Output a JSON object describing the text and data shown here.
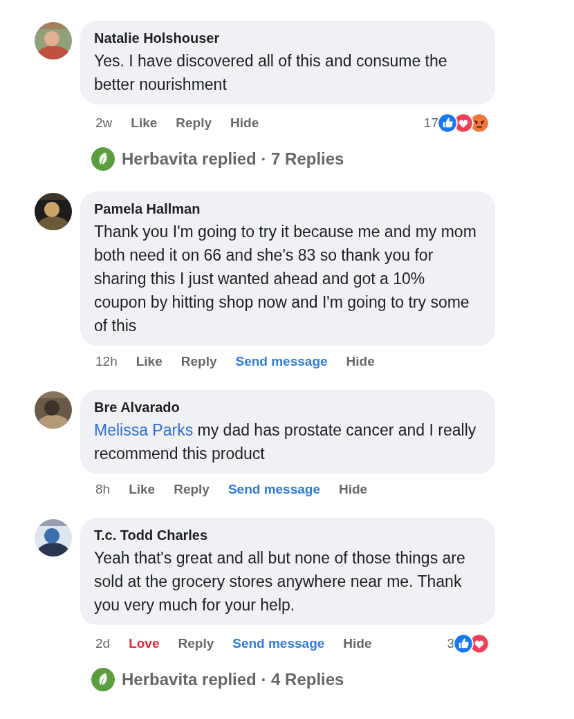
{
  "comments": [
    {
      "author": "Natalie Holshouser",
      "text": "Yes. I have discovered all of this and consume the better nourishment",
      "time": "2w",
      "actions": [
        {
          "label": "Like",
          "kind": "react",
          "reacted": false
        },
        {
          "label": "Reply",
          "kind": "reply"
        },
        {
          "label": "Hide",
          "kind": "hide"
        }
      ],
      "reactions": {
        "count": "17",
        "icons": [
          {
            "kind": "like"
          },
          {
            "kind": "love"
          },
          {
            "kind": "angry"
          }
        ]
      },
      "replies": "Herbavita replied · 7 Replies"
    },
    {
      "author": "Pamela Hallman",
      "text": "Thank you I'm going to try it because me and my mom both need it on 66 and she's 83 so thank you for sharing this I just wanted ahead and got a 10% coupon by hitting shop now and I'm going to try some of this",
      "time": "12h",
      "actions": [
        {
          "label": "Like",
          "kind": "react",
          "reacted": false
        },
        {
          "label": "Reply",
          "kind": "reply"
        },
        {
          "label": "Send message",
          "kind": "message"
        },
        {
          "label": "Hide",
          "kind": "hide"
        }
      ]
    },
    {
      "author": "Bre Alvarado",
      "mention": "Melissa Parks",
      "text": "my dad has prostate cancer and I really recommend this product",
      "time": "8h",
      "actions": [
        {
          "label": "Like",
          "kind": "react",
          "reacted": false
        },
        {
          "label": "Reply",
          "kind": "reply"
        },
        {
          "label": "Send message",
          "kind": "message"
        },
        {
          "label": "Hide",
          "kind": "hide"
        }
      ]
    },
    {
      "author": "T.c. Todd Charles",
      "text": "Yeah that's great and all but none of those things are sold at the grocery stores anywhere near me. Thank you very much for your help.",
      "time": "2d",
      "actions": [
        {
          "label": "Love",
          "kind": "react",
          "reacted": true
        },
        {
          "label": "Reply",
          "kind": "reply"
        },
        {
          "label": "Send message",
          "kind": "message"
        },
        {
          "label": "Hide",
          "kind": "hide"
        }
      ],
      "reactions": {
        "count": "3",
        "icons": [
          {
            "kind": "like"
          },
          {
            "kind": "love"
          }
        ]
      },
      "replies": "Herbavita replied · 4 Replies"
    }
  ]
}
